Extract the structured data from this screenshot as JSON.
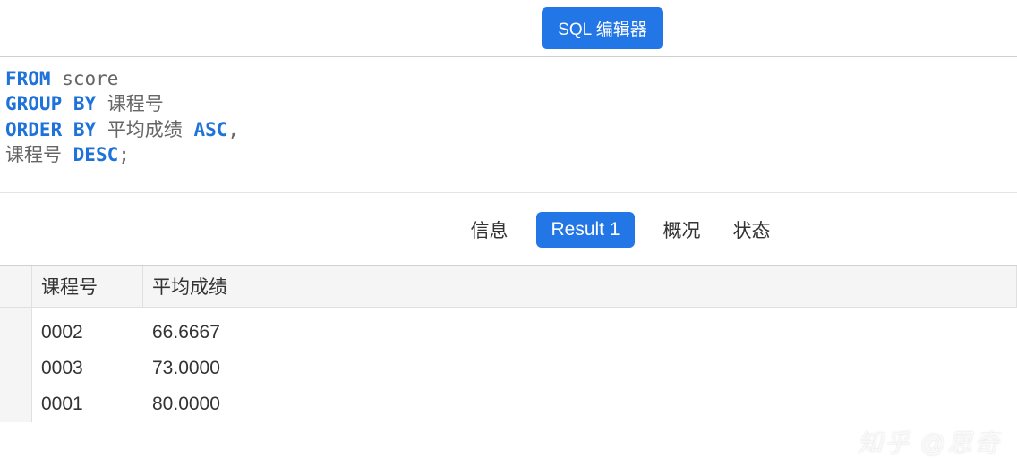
{
  "topbar": {
    "sql_editor_label": "SQL 编辑器"
  },
  "sql": {
    "kw_from": "FROM",
    "from_val": "score",
    "kw_group_by": "GROUP BY",
    "group_by_val": "课程号",
    "kw_order_by": "ORDER BY",
    "order_by_col1": "平均成绩",
    "kw_asc": "ASC",
    "comma": ",",
    "order_by_col2": "课程号",
    "kw_desc": "DESC",
    "semicolon": ";"
  },
  "tabs": {
    "info": "信息",
    "result": "Result 1",
    "profile": "概况",
    "status": "状态"
  },
  "table": {
    "headers": [
      "课程号",
      "平均成绩"
    ],
    "rows": [
      {
        "c1": "0002",
        "c2": "66.6667"
      },
      {
        "c1": "0003",
        "c2": "73.0000"
      },
      {
        "c1": "0001",
        "c2": "80.0000"
      }
    ]
  },
  "watermark": "知乎 @思奇"
}
